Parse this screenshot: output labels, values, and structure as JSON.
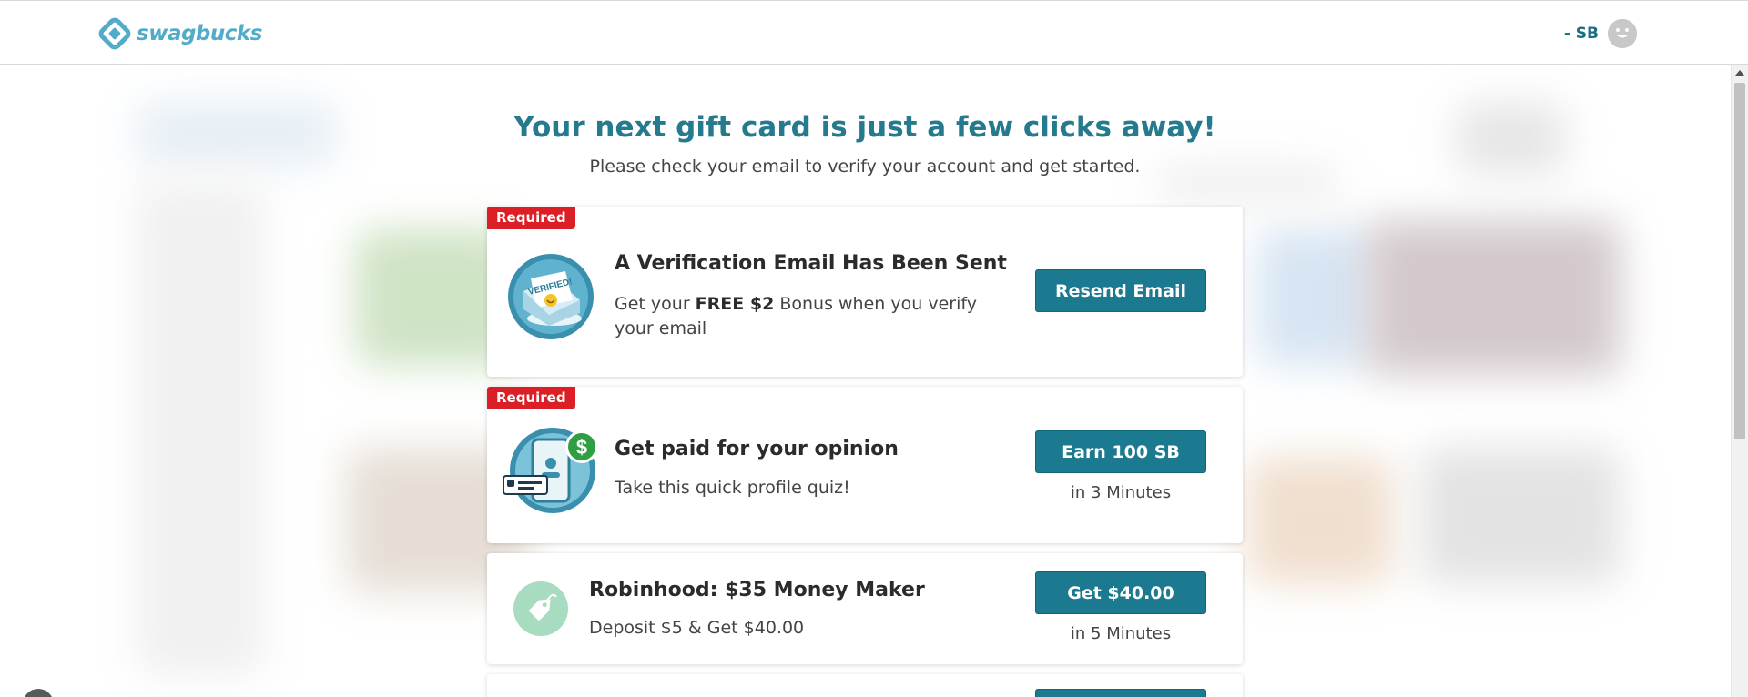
{
  "header": {
    "logo_text": "swagbucks",
    "user_balance": "- SB"
  },
  "main": {
    "headline": "Your next gift card is just a few clicks away!",
    "subline": "Please check your email to verify your account and get started."
  },
  "cards": [
    {
      "badge": "Required",
      "icon": "verified-envelope-icon",
      "icon_stamp_text": "VERIFIED!",
      "title": "A Verification Email Has Been Sent",
      "desc_prefix": "Get your ",
      "desc_bold": "FREE $2",
      "desc_suffix": " Bonus when you verify your email",
      "button": "Resend Email"
    },
    {
      "badge": "Required",
      "icon": "phone-profile-quiz-icon",
      "icon_coin_text": "$",
      "title": "Get paid for your opinion",
      "desc": "Take this quick profile quiz!",
      "button": "Earn 100 SB",
      "button_sub": "in 3 Minutes"
    },
    {
      "icon": "price-tag-icon",
      "title": "Robinhood: $35 Money Maker",
      "desc": "Deposit $5 & Get $40.00",
      "button": "Get $40.00",
      "button_sub": "in 5 Minutes"
    }
  ],
  "colors": {
    "brand": "#52acc9",
    "accent": "#1b7a8f",
    "headline": "#267a8d",
    "required": "#dc1f26"
  }
}
